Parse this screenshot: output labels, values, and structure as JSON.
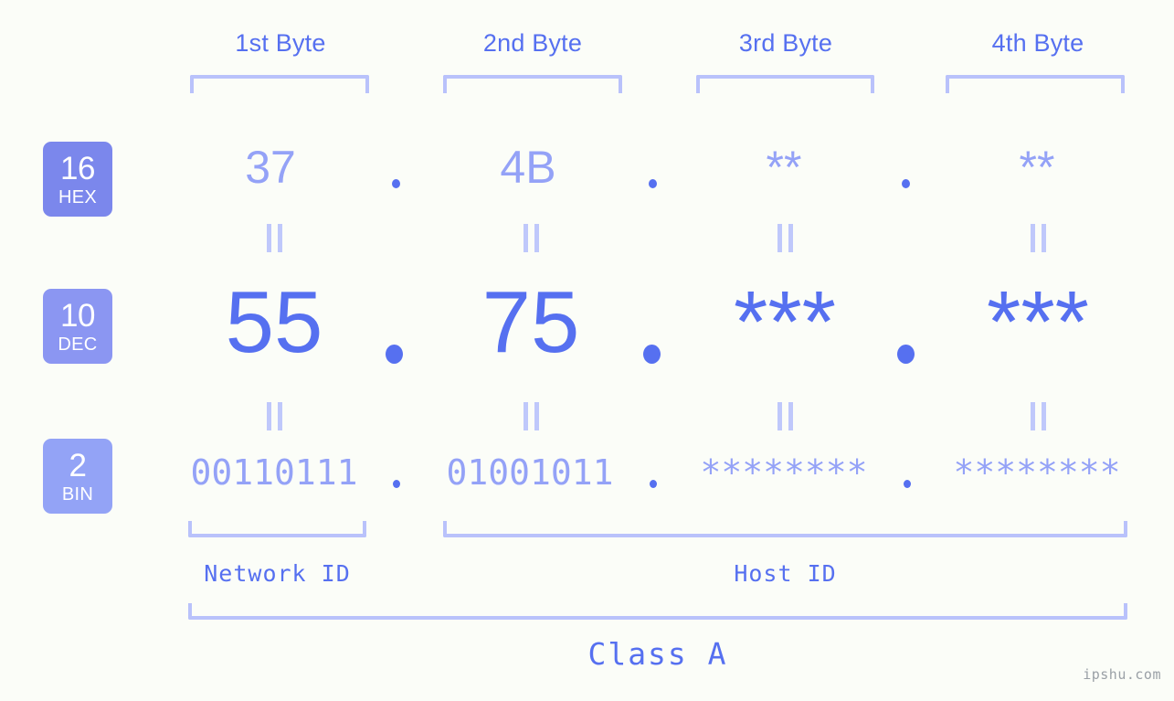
{
  "meta": {
    "background": "#fbfdf8",
    "accent_strong": "#5670f0",
    "accent_light": "#94a2f7",
    "bracket_color": "#b9c2fb",
    "watermark_color": "#9aa0a6"
  },
  "headers": {
    "byte1": "1st Byte",
    "byte2": "2nd Byte",
    "byte3": "3rd Byte",
    "byte4": "4th Byte"
  },
  "badges": [
    {
      "num": "16",
      "name": "HEX",
      "color": "#7b87ec"
    },
    {
      "num": "10",
      "name": "DEC",
      "color": "#8b96f2"
    },
    {
      "num": "2",
      "name": "BIN",
      "color": "#93a3f6"
    }
  ],
  "rows": {
    "hex": {
      "radix": "16",
      "radix_name": "HEX",
      "values": [
        "37",
        "4B",
        "**",
        "**"
      ],
      "separator": "."
    },
    "dec": {
      "radix": "10",
      "radix_name": "DEC",
      "values": [
        "55",
        "75",
        "***",
        "***"
      ],
      "separator": "."
    },
    "bin": {
      "radix": "2",
      "radix_name": "BIN",
      "values": [
        "00110111",
        "01001011",
        "********",
        "********"
      ],
      "separator": "."
    }
  },
  "connectors": {
    "glyph": "equals-rotated"
  },
  "footer": {
    "network_id": "Network ID",
    "host_id": "Host ID",
    "class": "Class A"
  },
  "watermark": "ipshu.com"
}
